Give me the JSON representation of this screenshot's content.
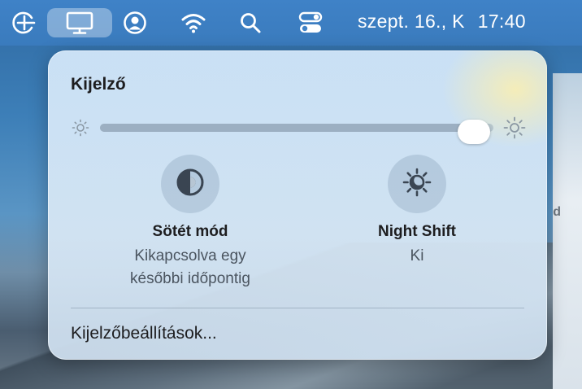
{
  "menubar": {
    "icons": [
      "add-circle-icon",
      "display-icon",
      "user-icon",
      "wifi-icon",
      "search-icon",
      "control-center-icon"
    ],
    "date": "szept. 16., K",
    "time": "17:40"
  },
  "panel": {
    "title": "Kijelző",
    "brightness": {
      "level": 0.95,
      "icons": [
        "sun-dim-icon",
        "sun-bright-icon"
      ]
    },
    "toggles": [
      {
        "label": "Sötét mód",
        "status_line1": "Kikapcsolva egy",
        "status_line2": "későbbi időpontig",
        "icon": "dark-mode-icon"
      },
      {
        "label": "Night Shift",
        "status_line1": "Ki",
        "icon": "night-shift-icon"
      }
    ],
    "settings_link": "Kijelzőbeállítások..."
  },
  "background": {
    "edge_text": "d"
  },
  "colors": {
    "menubar": "#3f82c7",
    "panel_bg": "#d0e5f8",
    "text": "#1d1d1f",
    "secondary_text": "#4b5560"
  }
}
